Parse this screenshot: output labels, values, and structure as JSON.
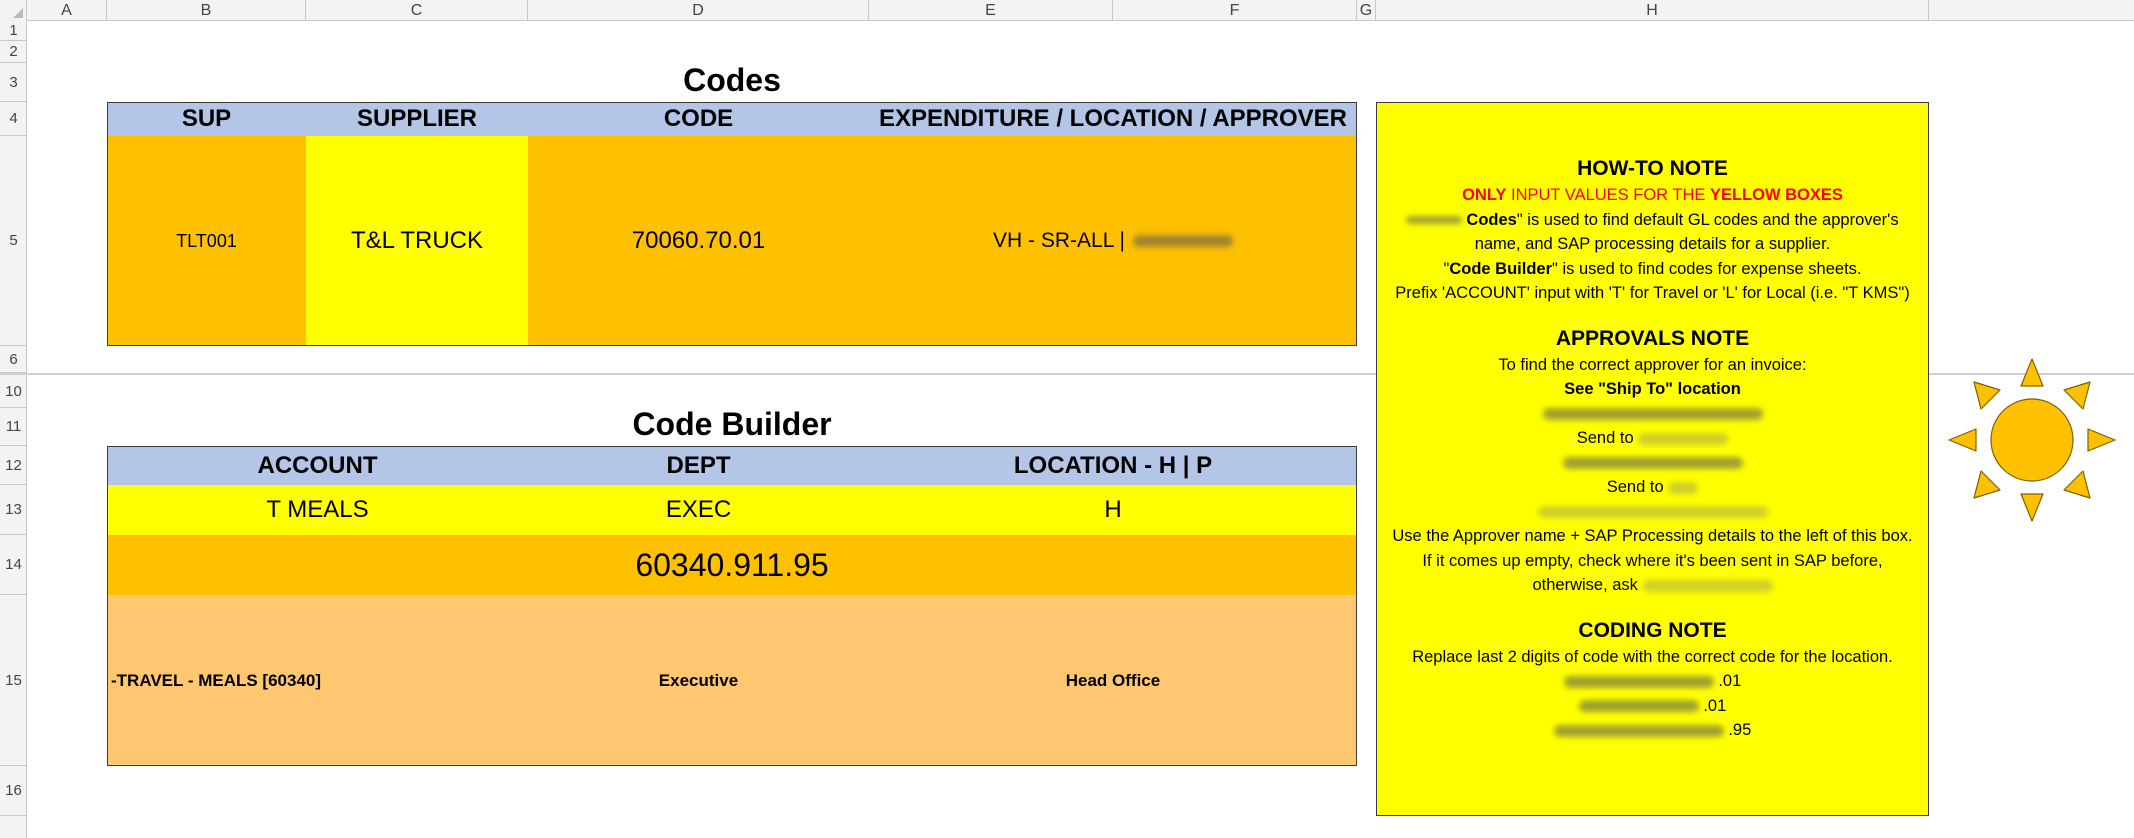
{
  "sheet": {
    "columns": [
      "A",
      "B",
      "C",
      "D",
      "E",
      "F",
      "G",
      "H"
    ],
    "rows": [
      "1",
      "2",
      "3",
      "4",
      "5",
      "6",
      "10",
      "11",
      "12",
      "13",
      "14",
      "15",
      "16"
    ]
  },
  "codes": {
    "title": "Codes",
    "headers": [
      "SUP",
      "SUPPLIER",
      "CODE",
      "EXPENDITURE / LOCATION / APPROVER"
    ],
    "row": {
      "sup": "TLT001",
      "supplier": "T&L TRUCK",
      "code": "70060.70.01",
      "expenditure": "VH - SR-ALL |"
    }
  },
  "code_builder": {
    "title": "Code Builder",
    "headers": [
      "ACCOUNT",
      "DEPT",
      "LOCATION - H | P"
    ],
    "inputs": {
      "account": "T MEALS",
      "dept": "EXEC",
      "location": "H"
    },
    "result": "60340.911.95",
    "descriptions": {
      "account": "-TRAVEL - MEALS [60340]",
      "dept": "Executive",
      "location": "Head Office"
    }
  },
  "note": {
    "howto_title": "HOW-TO NOTE",
    "only": "ONLY",
    "input_values": " INPUT VALUES FOR THE ",
    "yellow_boxes": "YELLOW BOXES",
    "codes_word": "Codes",
    "codes_desc": "\" is used to find default GL codes and the approver's",
    "codes_desc2": "name, and SAP processing details for a supplier.",
    "cb_quote_open": "\"",
    "cb_word": "Code Builder",
    "cb_desc": "\" is used to find codes for expense sheets.",
    "prefix": "Prefix 'ACCOUNT' input with 'T' for Travel or 'L' for Local (i.e. \"T KMS\")",
    "approvals_title": "APPROVALS NOTE",
    "approvals_l1": "To find the correct approver for an invoice:",
    "approvals_see": "See \"Ship To\" location",
    "send_to_1": "Send to",
    "send_to_2": "Send to",
    "approvals_l2": "Use the Approver name + SAP Processing details to the left of this box.",
    "approvals_l3": "If it comes up empty, check where it's been sent in SAP before,",
    "approvals_l4": "otherwise, ask",
    "coding_title": "CODING NOTE",
    "coding_l1": "Replace last 2 digits of code with the correct code for the location.",
    "coding_v1": ".01",
    "coding_v2": ".01",
    "coding_v3": ".95"
  },
  "colors": {
    "header_blue": "#b4c6e7",
    "orange": "#ffc000",
    "yellow": "#ffff00",
    "peach": "#ffc870",
    "red": "#ff0000"
  },
  "icons": {
    "sun": "sun-icon"
  }
}
